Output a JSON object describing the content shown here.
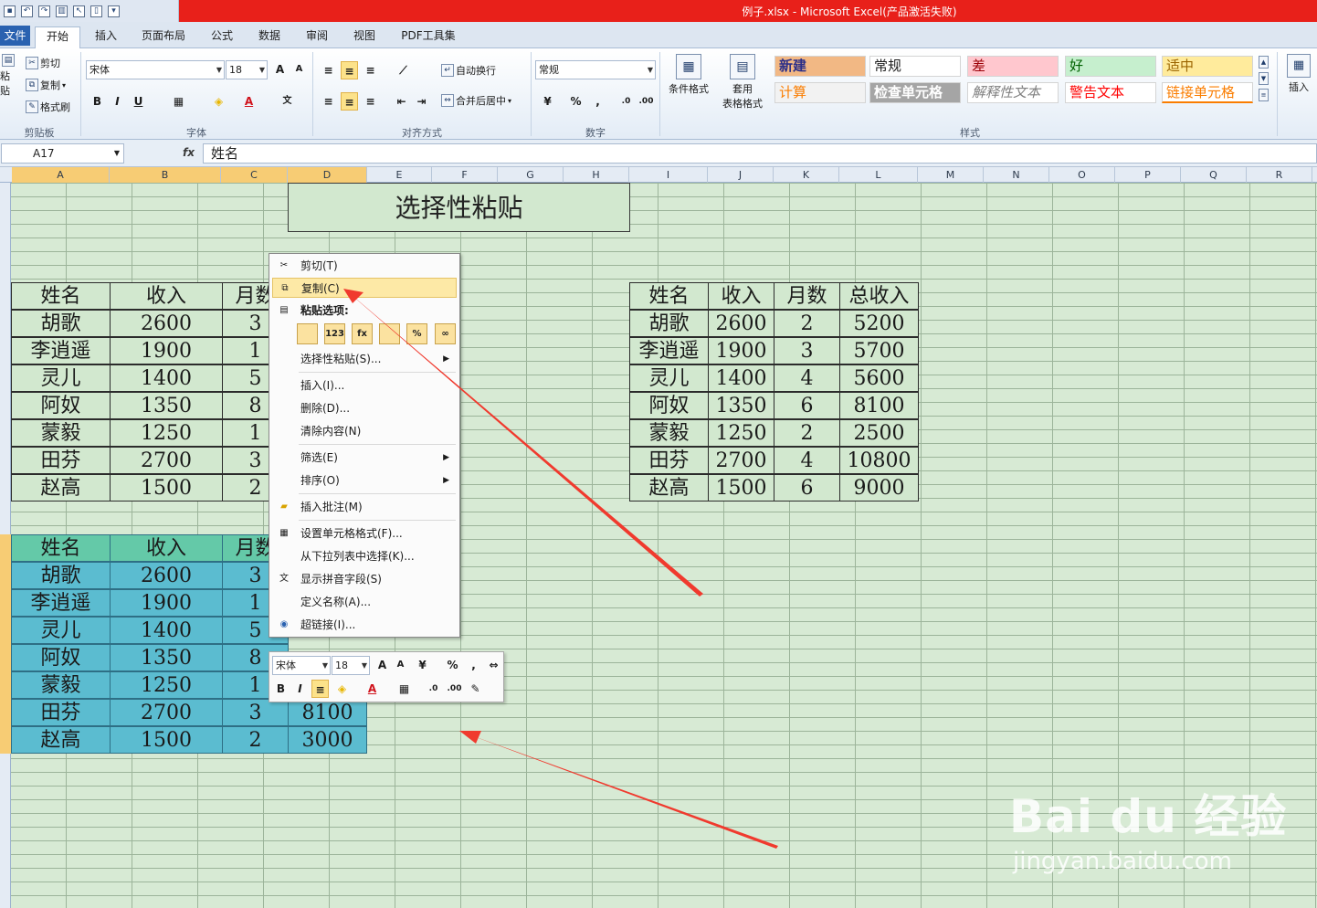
{
  "window": {
    "title": "例子.xlsx - Microsoft Excel(产品激活失败)"
  },
  "tabs": [
    "文件",
    "开始",
    "插入",
    "页面布局",
    "公式",
    "数据",
    "审阅",
    "视图",
    "PDF工具集"
  ],
  "ribbon": {
    "clipboard": {
      "paste": "粘贴",
      "cut": "剪切",
      "copy": "复制",
      "painter": "格式刷",
      "label": "剪贴板"
    },
    "font": {
      "family": "宋体",
      "size": "18",
      "label": "字体",
      "bold": "B",
      "italic": "I",
      "underline": "U"
    },
    "alignment": {
      "wrap": "自动换行",
      "merge": "合并后居中",
      "label": "对齐方式"
    },
    "number": {
      "format": "常规",
      "percent": "%",
      "comma": ",",
      "label": "数字"
    },
    "styles_group": {
      "conditional": "条件格式",
      "table_format": "套用\n表格格式",
      "label": "样式"
    },
    "styles": [
      {
        "name": "新建",
        "bg": "#f2b884",
        "color": "#2c2f88"
      },
      {
        "name": "常规",
        "bg": "#ffffff",
        "color": "#1e1e1e"
      },
      {
        "name": "差",
        "bg": "#ffc7ce",
        "color": "#9c0006"
      },
      {
        "name": "好",
        "bg": "#c6efce",
        "color": "#006100"
      },
      {
        "name": "适中",
        "bg": "#ffeb9c",
        "color": "#9c6500"
      },
      {
        "name": "计算",
        "bg": "#f2f2f2",
        "color": "#fa7d00"
      },
      {
        "name": "检查单元格",
        "bg": "#a5a5a5",
        "color": "#ffffff"
      },
      {
        "name": "解释性文本",
        "bg": "#ffffff",
        "color": "#7f7f7f"
      },
      {
        "name": "警告文本",
        "bg": "#ffffff",
        "color": "#ff0000"
      },
      {
        "name": "链接单元格",
        "bg": "#ffffff",
        "color": "#fa7d00"
      }
    ],
    "cells": {
      "insert": "插入"
    }
  },
  "formula_bar": {
    "name_box": "A17",
    "fx": "fx",
    "value": "姓名"
  },
  "columns": [
    "A",
    "B",
    "C",
    "D",
    "E",
    "F",
    "G",
    "H",
    "I",
    "J",
    "K",
    "L",
    "M",
    "N",
    "O",
    "P",
    "Q",
    "R"
  ],
  "banner": "选择性粘贴",
  "table_left": {
    "headers": [
      "姓名",
      "收入",
      "月数"
    ],
    "rows": [
      [
        "胡歌",
        "2600",
        "3"
      ],
      [
        "李逍遥",
        "1900",
        "1"
      ],
      [
        "灵儿",
        "1400",
        "5"
      ],
      [
        "阿奴",
        "1350",
        "8"
      ],
      [
        "蒙毅",
        "1250",
        "1"
      ],
      [
        "田芬",
        "2700",
        "3"
      ],
      [
        "赵高",
        "1500",
        "2"
      ]
    ]
  },
  "table_right": {
    "headers": [
      "姓名",
      "收入",
      "月数",
      "总收入"
    ],
    "rows": [
      [
        "胡歌",
        "2600",
        "2",
        "5200"
      ],
      [
        "李逍遥",
        "1900",
        "3",
        "5700"
      ],
      [
        "灵儿",
        "1400",
        "4",
        "5600"
      ],
      [
        "阿奴",
        "1350",
        "6",
        "8100"
      ],
      [
        "蒙毅",
        "1250",
        "2",
        "2500"
      ],
      [
        "田芬",
        "2700",
        "4",
        "10800"
      ],
      [
        "赵高",
        "1500",
        "6",
        "9000"
      ]
    ]
  },
  "table_selected": {
    "headers": [
      "姓名",
      "收入",
      "月数"
    ],
    "rows": [
      [
        "胡歌",
        "2600",
        "3"
      ],
      [
        "李逍遥",
        "1900",
        "1"
      ],
      [
        "灵儿",
        "1400",
        "5"
      ],
      [
        "阿奴",
        "1350",
        "8"
      ],
      [
        "蒙毅",
        "1250",
        "1"
      ],
      [
        "田芬",
        "2700",
        "3",
        "8100"
      ],
      [
        "赵高",
        "1500",
        "2",
        "3000"
      ]
    ]
  },
  "context_menu": {
    "cut": "剪切(T)",
    "copy": "复制(C)",
    "paste_options": "粘贴选项:",
    "paste_special": "选择性粘贴(S)...",
    "insert": "插入(I)...",
    "delete": "删除(D)...",
    "clear": "清除内容(N)",
    "filter": "筛选(E)",
    "sort": "排序(O)",
    "comment": "插入批注(M)",
    "format_cells": "设置单元格格式(F)...",
    "pick_list": "从下拉列表中选择(K)...",
    "phonetic": "显示拼音字段(S)",
    "define_name": "定义名称(A)...",
    "hyperlink": "超链接(I)..."
  },
  "paste_buttons": [
    "",
    "123",
    "fx",
    "",
    "%",
    "∞"
  ],
  "mini_toolbar": {
    "font": "宋体",
    "size": "18"
  },
  "watermark": {
    "logo": "Bai du 经验",
    "url": "jingyan.baidu.com"
  }
}
